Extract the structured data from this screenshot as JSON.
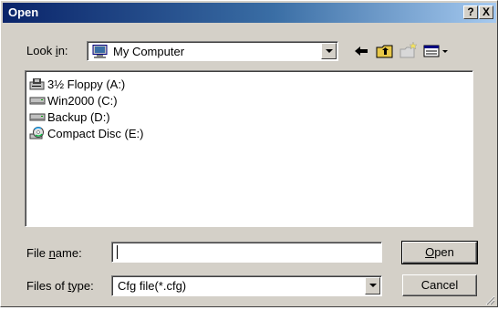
{
  "window": {
    "title": "Open",
    "help_label": "?",
    "close_label": "X"
  },
  "lookin": {
    "label_prefix": "Look ",
    "label_underlined": "i",
    "label_suffix": "n:",
    "value": "My Computer"
  },
  "toolbar": {
    "back_icon": "back-arrow-icon",
    "up_icon": "up-folder-icon",
    "new_folder_icon": "new-folder-icon",
    "views_icon": "view-menu-icon"
  },
  "files": [
    {
      "label": "3½ Floppy (A:)",
      "icon": "floppy-drive-icon"
    },
    {
      "label": "Win2000 (C:)",
      "icon": "hard-drive-icon"
    },
    {
      "label": "Backup (D:)",
      "icon": "hard-drive-icon"
    },
    {
      "label": "Compact Disc (E:)",
      "icon": "cd-drive-icon"
    }
  ],
  "filename": {
    "label_prefix": "File ",
    "label_underlined": "n",
    "label_suffix": "ame:",
    "value": ""
  },
  "filetype": {
    "label_prefix": "Files of ",
    "label_underlined": "t",
    "label_suffix": "ype:",
    "value": "Cfg file(*.cfg)"
  },
  "buttons": {
    "open_underlined": "O",
    "open_rest": "pen",
    "cancel": "Cancel"
  }
}
